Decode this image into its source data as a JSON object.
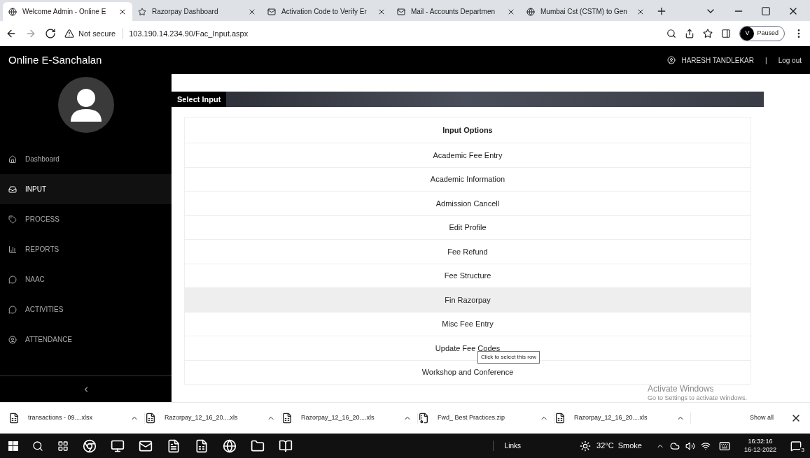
{
  "browser": {
    "tabs": [
      {
        "title": "Welcome Admin - Online E",
        "selected": true
      },
      {
        "title": "Razorpay Dashboard",
        "selected": false
      },
      {
        "title": "Activation Code to Verify Er",
        "selected": false
      },
      {
        "title": "Mail - Accounts Departmen",
        "selected": false
      },
      {
        "title": "Mumbai Cst (CSTM) to Gen",
        "selected": false
      }
    ],
    "security": "Not secure",
    "url": "103.190.14.234.90/Fac_Input.aspx",
    "profile_initial": "V",
    "profile_status": "Paused"
  },
  "header": {
    "title": "Online E-Sanchalan",
    "user": "HARESH TANDLEKAR",
    "separator": "|",
    "logout": "Log out"
  },
  "sidebar": {
    "items": [
      {
        "label": "Dashboard",
        "selected": false
      },
      {
        "label": "INPUT",
        "selected": true
      },
      {
        "label": "PROCESS",
        "selected": false
      },
      {
        "label": "REPORTS",
        "selected": false
      },
      {
        "label": "NAAC",
        "selected": false
      },
      {
        "label": "ACTIVITIES",
        "selected": false
      },
      {
        "label": "ATTENDANCE",
        "selected": false
      }
    ]
  },
  "panel": {
    "title": "Select Input",
    "table": {
      "header": "Input Options",
      "rows": [
        {
          "label": "Academic Fee Entry",
          "hovered": false
        },
        {
          "label": "Academic Information",
          "hovered": false
        },
        {
          "label": "Admission Cancell",
          "hovered": false
        },
        {
          "label": "Edit Profile",
          "hovered": false
        },
        {
          "label": "Fee Refund",
          "hovered": false
        },
        {
          "label": "Fee Structure",
          "hovered": false
        },
        {
          "label": "Fin Razorpay",
          "hovered": true
        },
        {
          "label": "Misc Fee Entry",
          "hovered": false
        },
        {
          "label": "Update Fee Codes",
          "hovered": false
        },
        {
          "label": "Workshop and Conference",
          "hovered": false
        }
      ]
    },
    "tooltip": "Click to select this row"
  },
  "activation_notice": {
    "title": "Activate Windows",
    "text": "Go to Settings to activate Windows."
  },
  "downloads": {
    "items": [
      {
        "name": "transactions - 09....xlsx",
        "kind": "sheet"
      },
      {
        "name": "Razorpay_12_16_20....xls",
        "kind": "sheet"
      },
      {
        "name": "Razorpay_12_16_20....xls",
        "kind": "sheet"
      },
      {
        "name": "Fwd_ Best Practices.zip",
        "kind": "zip"
      },
      {
        "name": "Razorpay_12_16_20....xls",
        "kind": "sheet"
      }
    ],
    "show_all": "Show all"
  },
  "taskbar": {
    "links": "Links",
    "weather": "32°C  Smoke",
    "time": "16:32:16",
    "date": "16-12-2022",
    "notifications": "3"
  }
}
